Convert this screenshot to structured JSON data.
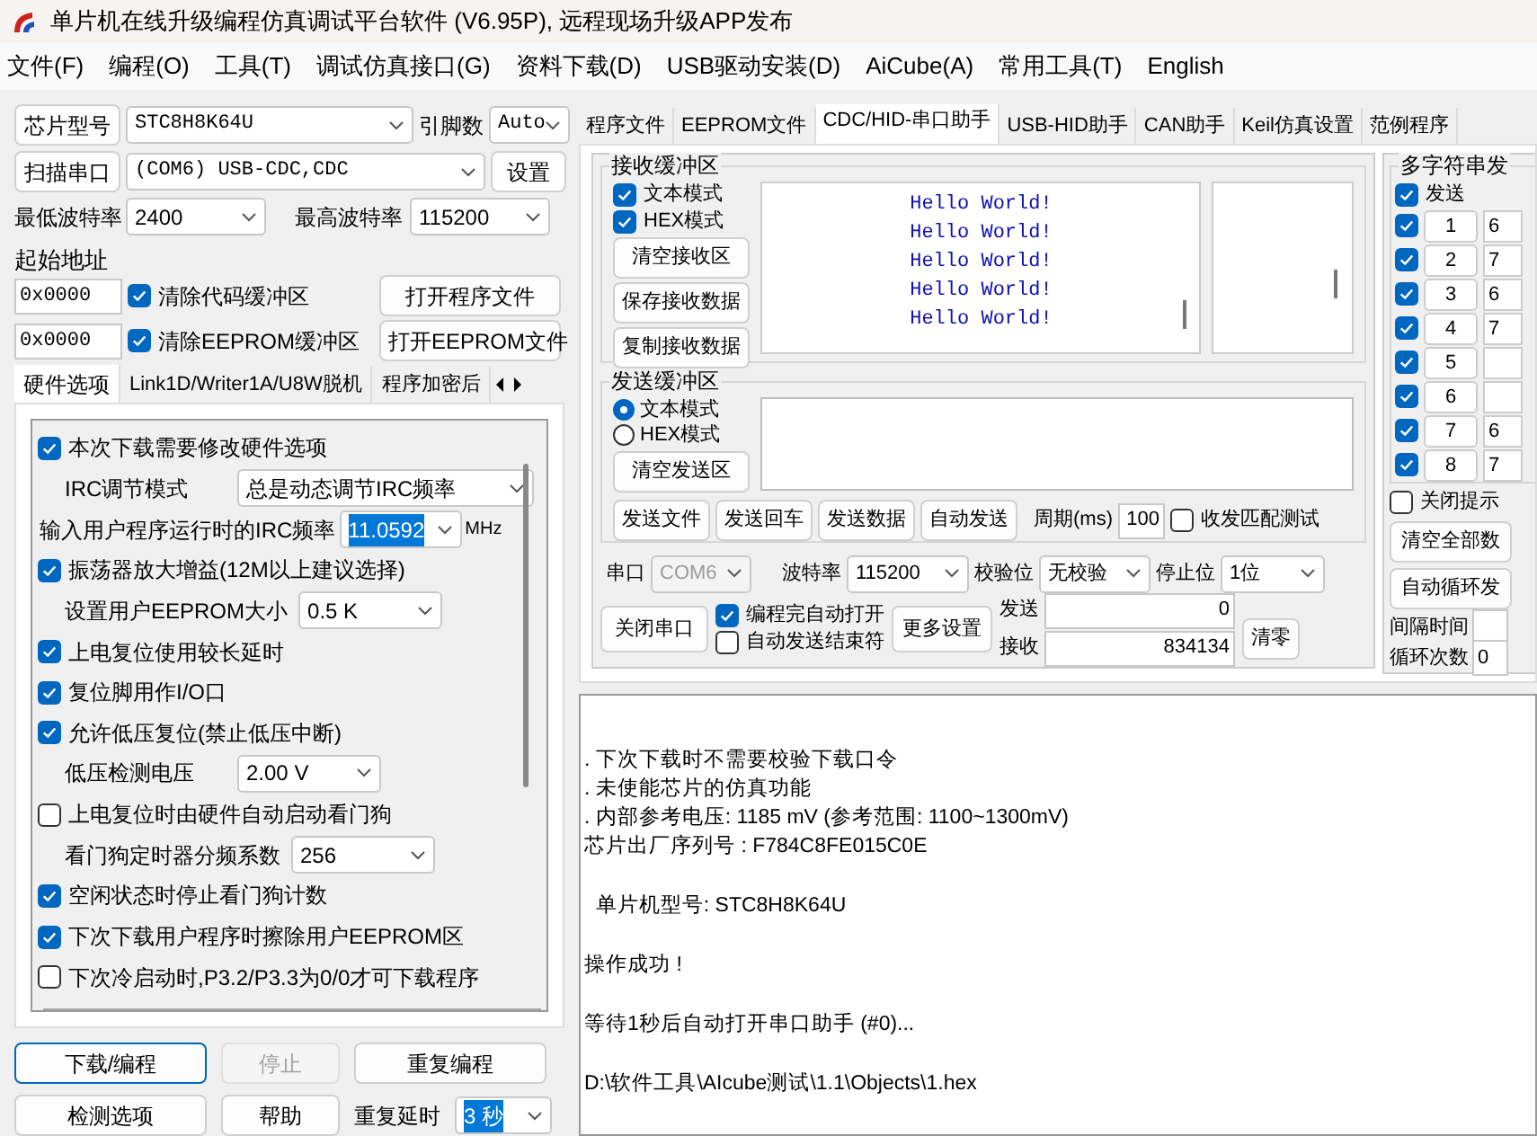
{
  "window": {
    "title": "单片机在线升级编程仿真调试平台软件 (V6.95P), 远程现场升级APP发布"
  },
  "menu": [
    "文件(F)",
    "编程(O)",
    "工具(T)",
    "调试仿真接口(G)",
    "资料下载(D)",
    "USB驱动安装(D)",
    "AiCube(A)",
    "常用工具(T)",
    "English"
  ],
  "left": {
    "chip_button": "芯片型号",
    "chip_value": "STC8H8K64U",
    "pins_label": "引脚数",
    "pins_value": "Auto",
    "scan_button": "扫描串口",
    "port_value": "(COM6) USB-CDC,CDC",
    "settings_button": "设置",
    "min_baud_label": "最低波特率",
    "min_baud": "2400",
    "max_baud_label": "最高波特率",
    "max_baud": "115200",
    "start_address_label": "起始地址",
    "code_address": "0x0000",
    "clear_code": {
      "label": "清除代码缓冲区",
      "checked": true
    },
    "open_program_button": "打开程序文件",
    "eeprom_address": "0x0000",
    "clear_eeprom": {
      "label": "清除EEPROM缓冲区",
      "checked": true
    },
    "open_eeprom_button": "打开EEPROM文件",
    "tabs": [
      {
        "label": "硬件选项",
        "selected": true
      },
      {
        "label": "Link1D/Writer1A/U8W脱机",
        "selected": false
      },
      {
        "label": "程序加密后",
        "selected": false
      }
    ],
    "options": [
      {
        "kind": "check",
        "label": "本次下载需要修改硬件选项",
        "checked": true
      },
      {
        "kind": "select",
        "label": "IRC调节模式",
        "value": "总是动态调节IRC频率"
      },
      {
        "kind": "frequency",
        "label": "输入用户程序运行时的IRC频率",
        "value": "11.0592",
        "unit": "MHz"
      },
      {
        "kind": "check",
        "label": "振荡器放大增益(12M以上建议选择)",
        "checked": true
      },
      {
        "kind": "select",
        "label": "设置用户EEPROM大小",
        "value": "0.5 K"
      },
      {
        "kind": "check",
        "label": "上电复位使用较长延时",
        "checked": true
      },
      {
        "kind": "check",
        "label": "复位脚用作I/O口",
        "checked": true
      },
      {
        "kind": "check",
        "label": "允许低压复位(禁止低压中断)",
        "checked": true
      },
      {
        "kind": "select",
        "label": "低压检测电压",
        "value": "2.00 V"
      },
      {
        "kind": "check",
        "label": "上电复位时由硬件自动启动看门狗",
        "checked": false
      },
      {
        "kind": "select",
        "label": "看门狗定时器分频系数",
        "value": "256"
      },
      {
        "kind": "check",
        "label": "空闲状态时停止看门狗计数",
        "checked": true
      },
      {
        "kind": "check",
        "label": "下次下载用户程序时擦除用户EEPROM区",
        "checked": true
      },
      {
        "kind": "check",
        "label": "下次冷启动时,P3.2/P3.3为0/0才可下载程序",
        "checked": false
      }
    ],
    "download_button": "下载/编程",
    "stop_button": {
      "label": "停止",
      "disabled": true
    },
    "repeat_button": "重复编程",
    "detect_button": "检测选项",
    "help_button": "帮助",
    "repeat_delay_label": "重复延时",
    "repeat_delay": "3 秒"
  },
  "right": {
    "tabs": [
      {
        "label": "程序文件",
        "selected": false
      },
      {
        "label": "EEPROM文件",
        "selected": false
      },
      {
        "label": "CDC/HID-串口助手",
        "selected": true
      },
      {
        "label": "USB-HID助手",
        "selected": false
      },
      {
        "label": "CAN助手",
        "selected": false
      },
      {
        "label": "Keil仿真设置",
        "selected": false
      },
      {
        "label": "范例程序",
        "selected": false
      }
    ],
    "receive": {
      "title": "接收缓冲区",
      "modes": [
        {
          "label": "文本模式",
          "checked": true
        },
        {
          "label": "HEX模式",
          "checked": true
        }
      ],
      "buttons": [
        "清空接收区",
        "保存接收数据",
        "复制接收数据"
      ],
      "lines": [
        "Hello World!",
        "Hello World!",
        "Hello World!",
        "Hello World!",
        "Hello World!"
      ]
    },
    "send": {
      "title": "发送缓冲区",
      "modes": [
        {
          "label": "文本模式",
          "selected": true
        },
        {
          "label": "HEX模式",
          "selected": false
        }
      ],
      "clear_button": "清空发送区",
      "buttons": [
        "发送文件",
        "发送回车",
        "发送数据",
        "自动发送"
      ],
      "period_label": "周期(ms)",
      "period": "100",
      "match_test": {
        "label": "收发匹配测试",
        "checked": false
      }
    },
    "port": {
      "port_label": "串口",
      "port": "COM6",
      "baud_label": "波特率",
      "baud": "115200",
      "parity_label": "校验位",
      "parity": "无校验",
      "stop_label": "停止位",
      "stop": "1位"
    },
    "close_port_button": "关闭串口",
    "auto_open": {
      "label": "编程完自动打开",
      "checked": true
    },
    "auto_terminator": {
      "label": "自动发送结束符",
      "checked": false
    },
    "more_button": "更多设置",
    "sent_label": "发送",
    "sent": "0",
    "received_label": "接收",
    "received": "834134",
    "reset_button": "清零",
    "multi": {
      "title": "多字符串发",
      "send": {
        "label": "发送",
        "checked": true
      },
      "rows": [
        {
          "label": "1",
          "checked": true,
          "value": "6"
        },
        {
          "label": "2",
          "checked": true,
          "value": "7"
        },
        {
          "label": "3",
          "checked": true,
          "value": "6"
        },
        {
          "label": "4",
          "checked": true,
          "value": "7"
        },
        {
          "label": "5",
          "checked": true
        },
        {
          "label": "6",
          "checked": true
        },
        {
          "label": "7",
          "checked": true,
          "value": "6"
        },
        {
          "label": "8",
          "checked": true,
          "value": "7"
        }
      ],
      "close_tips": {
        "label": "关闭提示",
        "checked": false
      },
      "clear_all_button": "清空全部数",
      "auto_loop_button": "自动循环发",
      "interval_label": "间隔时间",
      "loop_count_label": "循环次数",
      "loop_count": "0"
    },
    "log": [
      [
        ". 下次下载时不需要校验下载口令",
        ". 未使能芯片的仿真功能",
        ". 内部参考电压: 1185 mV (参考范围: 1100~1300mV)",
        "芯片出厂序列号 : F784C8FE015C0E"
      ],
      [
        "  单片机型号: STC8H8K64U"
      ],
      [
        "操作成功 !"
      ],
      [
        "等待1秒后自动打开串口助手 (#0)..."
      ],
      [
        "D:\\软件工具\\AIcube测试\\1.1\\Objects\\1.hex"
      ]
    ]
  }
}
